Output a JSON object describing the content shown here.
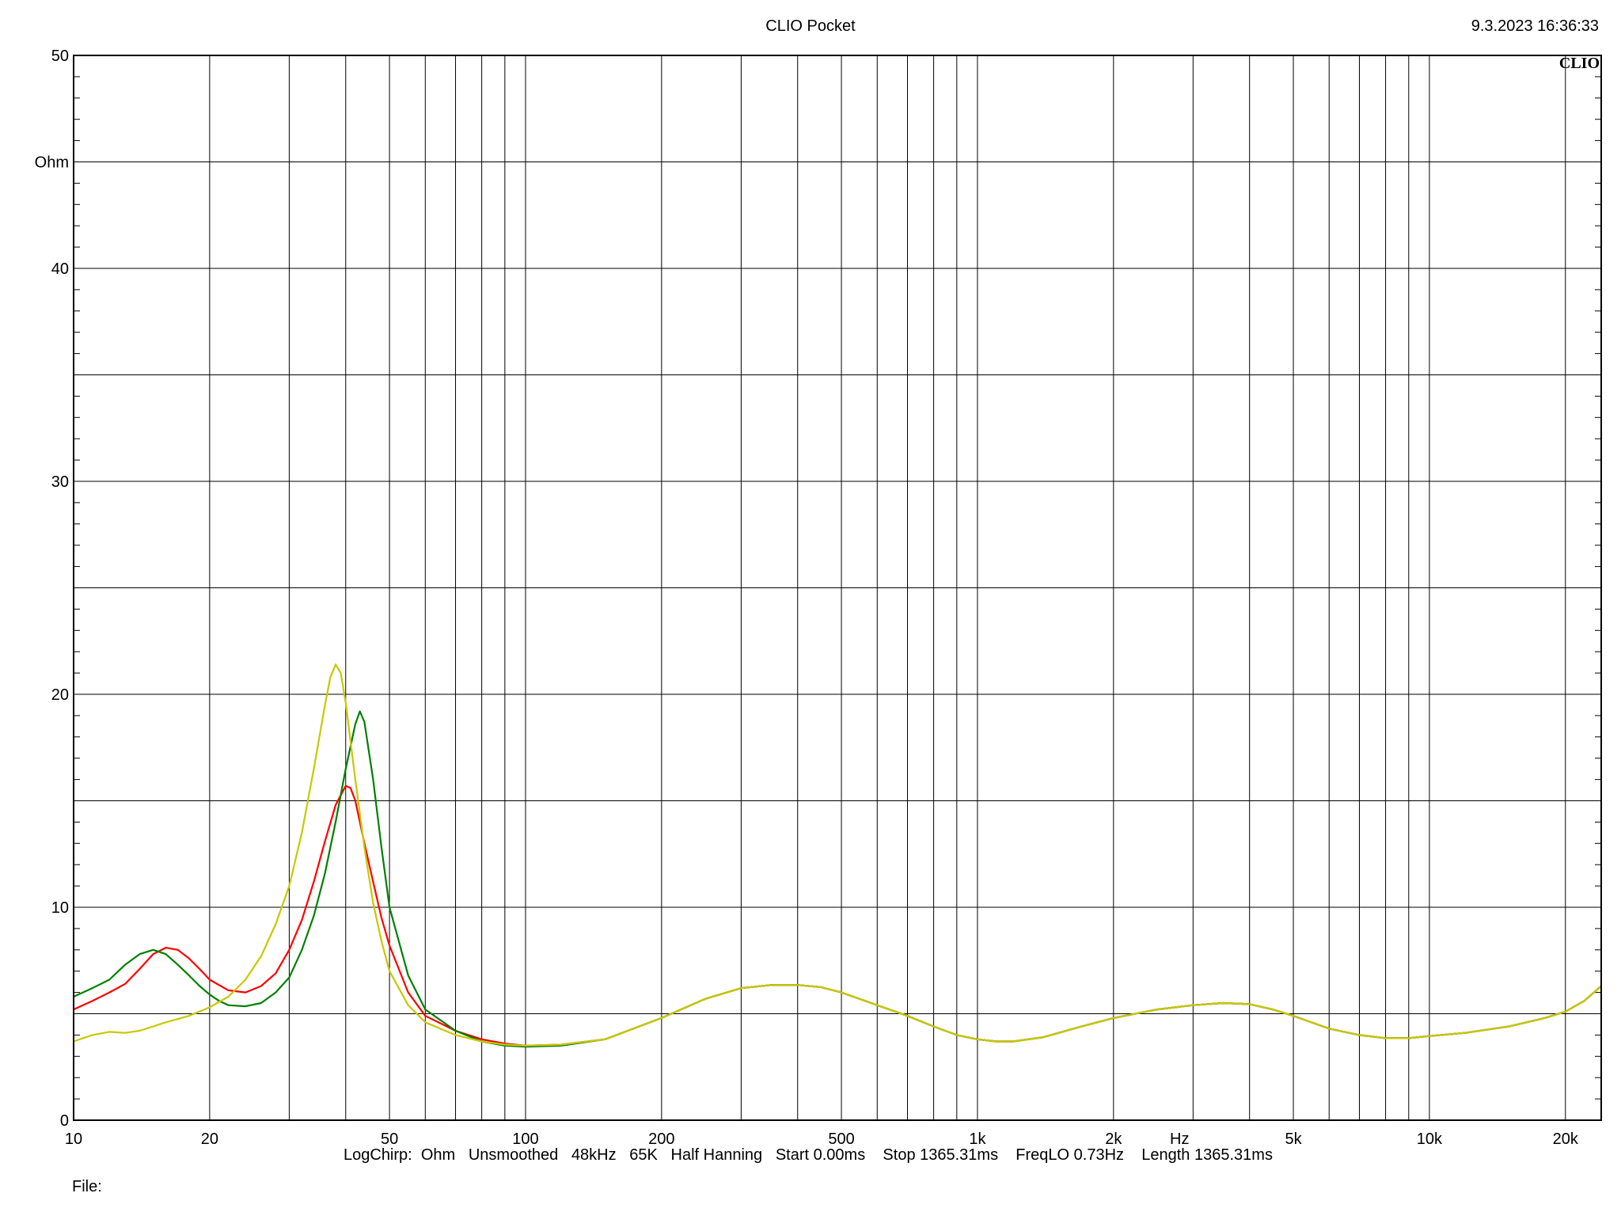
{
  "header": {
    "title": "CLIO Pocket",
    "timestamp": "9.3.2023 16:36:33",
    "brand": "CLIO"
  },
  "footer": {
    "info": "LogChirp:  Ohm   Unsmoothed   48kHz   65K   Half Hanning   Start 0.00ms    Stop 1365.31ms    FreqLO 0.73Hz    Length 1365.31ms",
    "file_label": "File:"
  },
  "chart_data": {
    "type": "line",
    "title": "CLIO Pocket",
    "xlabel": "Hz",
    "ylabel": "Ohm",
    "x_scale": "log",
    "xlim": [
      10,
      24000
    ],
    "ylim": [
      0,
      50
    ],
    "grid": true,
    "x_ticks": [
      {
        "value": 10,
        "label": "10"
      },
      {
        "value": 20,
        "label": "20"
      },
      {
        "value": 50,
        "label": "50"
      },
      {
        "value": 100,
        "label": "100"
      },
      {
        "value": 200,
        "label": "200"
      },
      {
        "value": 500,
        "label": "500"
      },
      {
        "value": 1000,
        "label": "1k"
      },
      {
        "value": 2000,
        "label": "2k"
      },
      {
        "value": 5000,
        "label": "5k"
      },
      {
        "value": 10000,
        "label": "10k"
      },
      {
        "value": 20000,
        "label": "20k"
      }
    ],
    "y_ticks": [
      {
        "value": 0,
        "label": "0"
      },
      {
        "value": 10,
        "label": "10"
      },
      {
        "value": 20,
        "label": "20"
      },
      {
        "value": 30,
        "label": "30"
      },
      {
        "value": 40,
        "label": "40"
      },
      {
        "value": 50,
        "label": "50"
      }
    ],
    "series": [
      {
        "color": "#ff0000",
        "points": [
          [
            10,
            5.2
          ],
          [
            11,
            5.6
          ],
          [
            12,
            6.0
          ],
          [
            13,
            6.4
          ],
          [
            14,
            7.1
          ],
          [
            15,
            7.8
          ],
          [
            16,
            8.1
          ],
          [
            17,
            8.0
          ],
          [
            18,
            7.6
          ],
          [
            19,
            7.1
          ],
          [
            20,
            6.6
          ],
          [
            22,
            6.1
          ],
          [
            24,
            6.0
          ],
          [
            26,
            6.3
          ],
          [
            28,
            6.9
          ],
          [
            30,
            8.0
          ],
          [
            32,
            9.4
          ],
          [
            34,
            11.2
          ],
          [
            36,
            13.1
          ],
          [
            38,
            14.8
          ],
          [
            40,
            15.7
          ],
          [
            41,
            15.6
          ],
          [
            42,
            15.0
          ],
          [
            44,
            13.0
          ],
          [
            46,
            11.2
          ],
          [
            48,
            9.5
          ],
          [
            50,
            8.2
          ],
          [
            55,
            6.0
          ],
          [
            60,
            4.9
          ],
          [
            70,
            4.2
          ],
          [
            80,
            3.8
          ],
          [
            90,
            3.6
          ],
          [
            100,
            3.5
          ],
          [
            120,
            3.55
          ],
          [
            150,
            3.8
          ],
          [
            200,
            4.8
          ],
          [
            250,
            5.7
          ],
          [
            300,
            6.2
          ],
          [
            350,
            6.35
          ],
          [
            400,
            6.35
          ],
          [
            450,
            6.25
          ],
          [
            500,
            6.0
          ],
          [
            600,
            5.4
          ],
          [
            700,
            4.9
          ],
          [
            800,
            4.4
          ],
          [
            900,
            4.0
          ],
          [
            1000,
            3.8
          ],
          [
            1100,
            3.7
          ],
          [
            1200,
            3.7
          ],
          [
            1400,
            3.9
          ],
          [
            1700,
            4.4
          ],
          [
            2000,
            4.8
          ],
          [
            2500,
            5.2
          ],
          [
            3000,
            5.4
          ],
          [
            3500,
            5.5
          ],
          [
            4000,
            5.45
          ],
          [
            4500,
            5.2
          ],
          [
            5000,
            4.9
          ],
          [
            6000,
            4.3
          ],
          [
            7000,
            4.0
          ],
          [
            8000,
            3.85
          ],
          [
            9000,
            3.85
          ],
          [
            10000,
            3.95
          ],
          [
            12000,
            4.1
          ],
          [
            15000,
            4.4
          ],
          [
            18000,
            4.8
          ],
          [
            20000,
            5.1
          ],
          [
            22000,
            5.6
          ],
          [
            24000,
            6.3
          ]
        ]
      },
      {
        "color": "#008000",
        "points": [
          [
            10,
            5.8
          ],
          [
            11,
            6.2
          ],
          [
            12,
            6.6
          ],
          [
            13,
            7.3
          ],
          [
            14,
            7.8
          ],
          [
            15,
            8.0
          ],
          [
            16,
            7.8
          ],
          [
            17,
            7.3
          ],
          [
            18,
            6.8
          ],
          [
            19,
            6.3
          ],
          [
            20,
            5.9
          ],
          [
            21,
            5.6
          ],
          [
            22,
            5.4
          ],
          [
            24,
            5.35
          ],
          [
            26,
            5.5
          ],
          [
            28,
            6.0
          ],
          [
            30,
            6.7
          ],
          [
            32,
            8.0
          ],
          [
            34,
            9.6
          ],
          [
            36,
            11.6
          ],
          [
            38,
            14.0
          ],
          [
            40,
            16.5
          ],
          [
            42,
            18.6
          ],
          [
            43,
            19.2
          ],
          [
            44,
            18.7
          ],
          [
            46,
            16.0
          ],
          [
            48,
            12.8
          ],
          [
            50,
            10.0
          ],
          [
            55,
            6.8
          ],
          [
            60,
            5.2
          ],
          [
            70,
            4.2
          ],
          [
            80,
            3.7
          ],
          [
            90,
            3.5
          ],
          [
            100,
            3.45
          ],
          [
            120,
            3.5
          ],
          [
            150,
            3.8
          ],
          [
            200,
            4.8
          ],
          [
            250,
            5.7
          ],
          [
            300,
            6.2
          ],
          [
            350,
            6.35
          ],
          [
            400,
            6.35
          ],
          [
            450,
            6.25
          ],
          [
            500,
            6.0
          ],
          [
            600,
            5.4
          ],
          [
            700,
            4.9
          ],
          [
            800,
            4.4
          ],
          [
            900,
            4.0
          ],
          [
            1000,
            3.8
          ],
          [
            1100,
            3.7
          ],
          [
            1200,
            3.7
          ],
          [
            1400,
            3.9
          ],
          [
            1700,
            4.4
          ],
          [
            2000,
            4.8
          ],
          [
            2500,
            5.2
          ],
          [
            3000,
            5.4
          ],
          [
            3500,
            5.5
          ],
          [
            4000,
            5.45
          ],
          [
            4500,
            5.2
          ],
          [
            5000,
            4.9
          ],
          [
            6000,
            4.3
          ],
          [
            7000,
            4.0
          ],
          [
            8000,
            3.85
          ],
          [
            9000,
            3.85
          ],
          [
            10000,
            3.95
          ],
          [
            12000,
            4.1
          ],
          [
            15000,
            4.4
          ],
          [
            18000,
            4.8
          ],
          [
            20000,
            5.1
          ],
          [
            22000,
            5.6
          ],
          [
            24000,
            6.3
          ]
        ]
      },
      {
        "color": "#c8c800",
        "points": [
          [
            10,
            3.7
          ],
          [
            11,
            4.0
          ],
          [
            12,
            4.15
          ],
          [
            13,
            4.1
          ],
          [
            14,
            4.2
          ],
          [
            15,
            4.4
          ],
          [
            16,
            4.6
          ],
          [
            18,
            4.9
          ],
          [
            20,
            5.3
          ],
          [
            22,
            5.8
          ],
          [
            24,
            6.6
          ],
          [
            26,
            7.7
          ],
          [
            28,
            9.2
          ],
          [
            30,
            11.0
          ],
          [
            32,
            13.5
          ],
          [
            34,
            16.5
          ],
          [
            36,
            19.5
          ],
          [
            37,
            20.8
          ],
          [
            38,
            21.4
          ],
          [
            39,
            21.0
          ],
          [
            40,
            19.6
          ],
          [
            42,
            16.0
          ],
          [
            44,
            12.8
          ],
          [
            46,
            10.2
          ],
          [
            48,
            8.4
          ],
          [
            50,
            7.0
          ],
          [
            55,
            5.4
          ],
          [
            60,
            4.6
          ],
          [
            70,
            4.0
          ],
          [
            80,
            3.7
          ],
          [
            90,
            3.55
          ],
          [
            100,
            3.5
          ],
          [
            120,
            3.55
          ],
          [
            150,
            3.8
          ],
          [
            200,
            4.8
          ],
          [
            250,
            5.7
          ],
          [
            300,
            6.2
          ],
          [
            350,
            6.35
          ],
          [
            400,
            6.35
          ],
          [
            450,
            6.25
          ],
          [
            500,
            6.0
          ],
          [
            600,
            5.4
          ],
          [
            700,
            4.9
          ],
          [
            800,
            4.4
          ],
          [
            900,
            4.0
          ],
          [
            1000,
            3.8
          ],
          [
            1100,
            3.7
          ],
          [
            1200,
            3.7
          ],
          [
            1400,
            3.9
          ],
          [
            1700,
            4.4
          ],
          [
            2000,
            4.8
          ],
          [
            2500,
            5.2
          ],
          [
            3000,
            5.4
          ],
          [
            3500,
            5.5
          ],
          [
            4000,
            5.45
          ],
          [
            4500,
            5.2
          ],
          [
            5000,
            4.9
          ],
          [
            6000,
            4.3
          ],
          [
            7000,
            4.0
          ],
          [
            8000,
            3.85
          ],
          [
            9000,
            3.85
          ],
          [
            10000,
            3.95
          ],
          [
            12000,
            4.1
          ],
          [
            15000,
            4.4
          ],
          [
            18000,
            4.8
          ],
          [
            20000,
            5.1
          ],
          [
            22000,
            5.6
          ],
          [
            24000,
            6.3
          ]
        ]
      }
    ]
  }
}
